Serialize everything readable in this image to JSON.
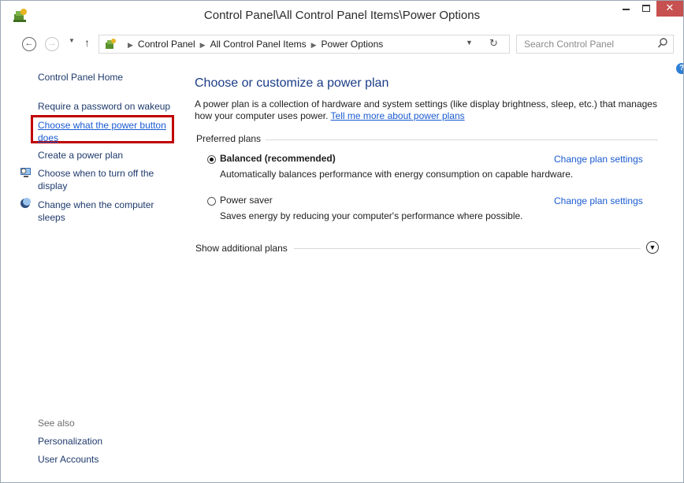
{
  "window": {
    "title": "Control Panel\\All Control Panel Items\\Power Options",
    "close_glyph": "✕"
  },
  "nav": {
    "back_glyph": "←",
    "forward_glyph": "→",
    "up_glyph": "↑",
    "dropdown_glyph": "▼",
    "refresh_glyph": "↻",
    "breadcrumbs": [
      "Control Panel",
      "All Control Panel Items",
      "Power Options"
    ],
    "search_placeholder": "Search Control Panel"
  },
  "help_glyph": "?",
  "sidebar": {
    "home": "Control Panel Home",
    "require_password": "Require a password on wakeup",
    "power_button": "Choose what the power button does",
    "create_plan": "Create a power plan",
    "turn_off_display": "Choose when to turn off the display",
    "computer_sleeps": "Change when the computer sleeps",
    "see_also_heading": "See also",
    "see_also": [
      "Personalization",
      "User Accounts"
    ]
  },
  "main": {
    "title": "Choose or customize a power plan",
    "description": "A power plan is a collection of hardware and system settings (like display brightness, sleep, etc.) that manages how your computer uses power.",
    "description_link": "Tell me more about power plans",
    "preferred_label": "Preferred plans",
    "plans": [
      {
        "name": "Balanced (recommended)",
        "description": "Automatically balances performance with energy consumption on capable hardware.",
        "link": "Change plan settings",
        "selected": true
      },
      {
        "name": "Power saver",
        "description": "Saves energy by reducing your computer's performance where possible.",
        "link": "Change plan settings",
        "selected": false
      }
    ],
    "show_additional": "Show additional plans",
    "expand_glyph": "▼"
  },
  "colors": {
    "accent_link": "#1a5bd1",
    "title_blue": "#1a3c86",
    "highlight_red": "#c00000",
    "close_button": "#c75050"
  }
}
